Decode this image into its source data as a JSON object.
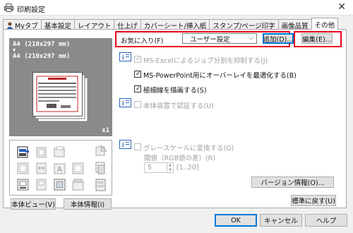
{
  "window": {
    "title": "印刷設定",
    "close_glyph": "✕"
  },
  "tabs": [
    {
      "label": "Myタブ"
    },
    {
      "label": "基本設定"
    },
    {
      "label": "レイアウト"
    },
    {
      "label": "仕上げ"
    },
    {
      "label": "カバーシート/挿入紙"
    },
    {
      "label": "スタンプ/ページ印字"
    },
    {
      "label": "画像品質"
    },
    {
      "label": "その他"
    }
  ],
  "active_tab": "その他",
  "preview": {
    "paper_line1": "A4 (210x297 mm)",
    "arrow": "▼",
    "paper_line2": "A4 (210x297 mm)",
    "copies": "x1"
  },
  "left_buttons": {
    "printer_view": "本体ビュー(V)",
    "printer_info": "本体情報(I)"
  },
  "favorites": {
    "label": "お気に入り(F)",
    "selected": "ユーザー設定",
    "add_button": "追加(D)...",
    "edit_button": "編集(E)..."
  },
  "options": [
    {
      "label": "MS-Excelによるジョブ分割を抑制する(J)",
      "checked": true,
      "enabled": false
    },
    {
      "label": "MS-PowerPoint用にオーバーレイを最適化する(B)",
      "checked": true,
      "enabled": true
    },
    {
      "label": "極細線を描画する(S)",
      "checked": true,
      "enabled": true
    },
    {
      "label": "本体装置で認証する(U)",
      "checked": false,
      "enabled": false
    },
    {
      "label": "グレースケールに変換する(G)",
      "checked": false,
      "enabled": false
    }
  ],
  "threshold": {
    "label": "閾値（RGB値の差）(R)",
    "value": "5",
    "range": "[1..20]"
  },
  "version_button": "バージョン情報(O)...",
  "default_button": "標準に戻す(U)",
  "dialog_buttons": {
    "ok": "OK",
    "cancel": "キャンセル",
    "help": "ヘルプ"
  },
  "colors": {
    "red_highlight": "#e8001c",
    "focus_blue": "#0078d7",
    "preview_gray": "#8a8a8a"
  }
}
